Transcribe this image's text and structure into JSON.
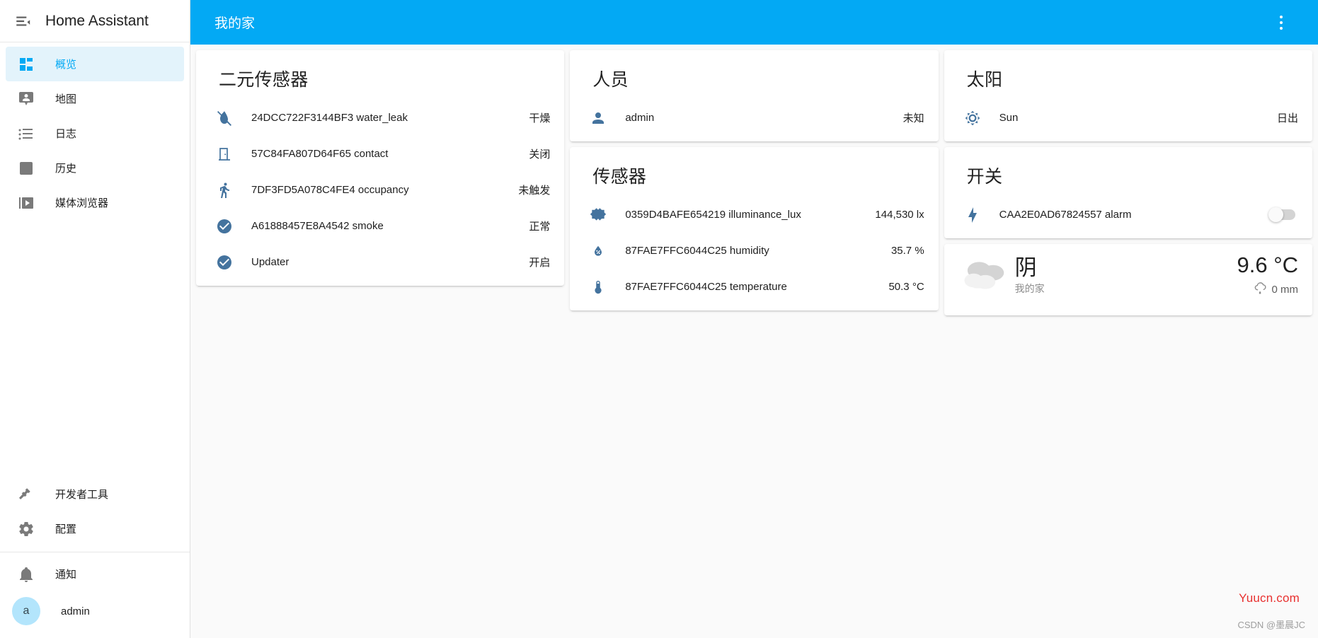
{
  "sidebar": {
    "title": "Home Assistant",
    "menu_icon": "menu-collapse-icon",
    "items": [
      {
        "label": "概览",
        "icon": "view-dashboard-icon",
        "active": true
      },
      {
        "label": "地图",
        "icon": "map-marker-account-icon",
        "active": false
      },
      {
        "label": "日志",
        "icon": "format-list-bulleted-icon",
        "active": false
      },
      {
        "label": "历史",
        "icon": "chart-box-icon",
        "active": false
      },
      {
        "label": "媒体浏览器",
        "icon": "play-box-multiple-icon",
        "active": false
      }
    ],
    "tools": [
      {
        "label": "开发者工具",
        "icon": "hammer-icon"
      },
      {
        "label": "配置",
        "icon": "cog-icon"
      }
    ],
    "notifications": {
      "label": "通知",
      "icon": "bell-icon"
    },
    "user": {
      "label": "admin",
      "initial": "a",
      "avatar_color": "#b3e5fc"
    }
  },
  "header": {
    "title": "我的家",
    "overflow_icon": "dots-vertical-icon",
    "accent_color": "#03a9f4"
  },
  "cards": {
    "binary_sensor": {
      "title": "二元传感器",
      "rows": [
        {
          "icon": "water-off-icon",
          "name": "24DCC722F3144BF3 water_leak",
          "value": "干燥"
        },
        {
          "icon": "door-closed-icon",
          "name": "57C84FA807D64F65 contact",
          "value": "关闭"
        },
        {
          "icon": "walk-icon",
          "name": "7DF3FD5A078C4FE4 occupancy",
          "value": "未触发"
        },
        {
          "icon": "check-circle-icon",
          "name": "A61888457E8A4542 smoke",
          "value": "正常"
        },
        {
          "icon": "check-circle-icon",
          "name": "Updater",
          "value": "开启"
        }
      ]
    },
    "person": {
      "title": "人员",
      "rows": [
        {
          "icon": "account-icon",
          "name": "admin",
          "value": "未知"
        }
      ]
    },
    "sensor": {
      "title": "传感器",
      "rows": [
        {
          "icon": "brightness-icon",
          "name": "0359D4BAFE654219 illuminance_lux",
          "value": "144,530 lx"
        },
        {
          "icon": "water-percent-icon",
          "name": "87FAE7FFC6044C25 humidity",
          "value": "35.7 %"
        },
        {
          "icon": "thermometer-icon",
          "name": "87FAE7FFC6044C25 temperature",
          "value": "50.3 °C"
        }
      ]
    },
    "sun": {
      "title": "太阳",
      "rows": [
        {
          "icon": "weather-sunny-icon",
          "name": "Sun",
          "value": "日出"
        }
      ]
    },
    "switch": {
      "title": "开关",
      "rows": [
        {
          "icon": "flash-icon",
          "name": "CAA2E0AD67824557 alarm",
          "toggle_on": false
        }
      ]
    },
    "weather": {
      "icon": "weather-cloudy-icon",
      "state": "阴",
      "location": "我的家",
      "temperature": "9.6 °C",
      "precipitation": "0 mm",
      "precip_icon": "weather-rainy-icon"
    }
  },
  "watermarks": {
    "primary": "Yuucn.com",
    "primary_color": "#e8302f",
    "secondary": "CSDN @墨晨JC"
  }
}
